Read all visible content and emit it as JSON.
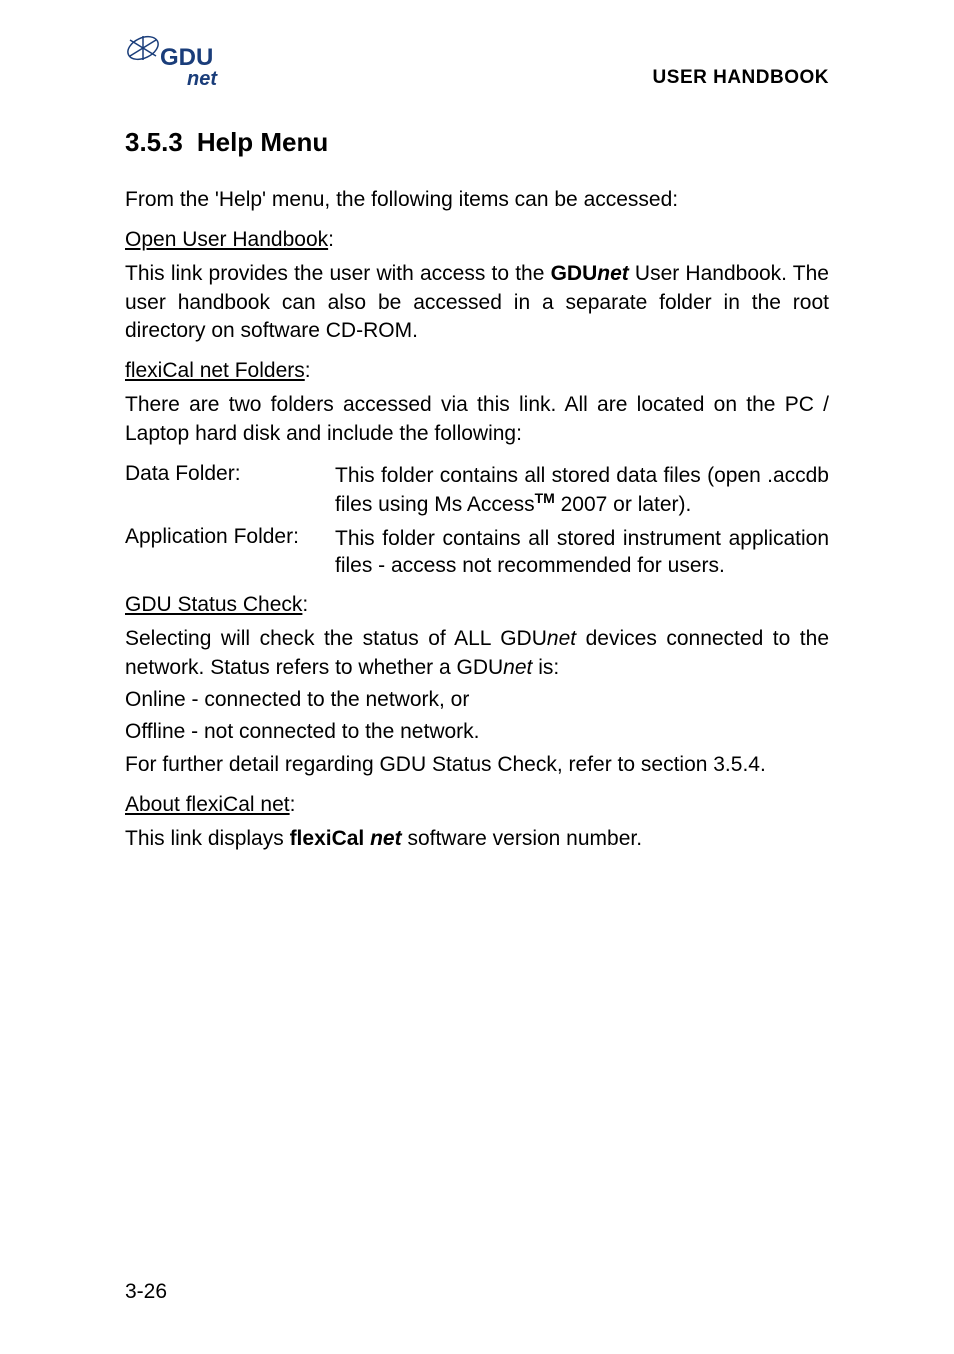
{
  "header": {
    "logo_text_1": "GDU",
    "logo_text_2": "net",
    "title": "USER HANDBOOK"
  },
  "section": {
    "number": "3.5.3",
    "title": "Help Menu"
  },
  "intro": "From the 'Help' menu, the following items can be accessed:",
  "open_handbook": {
    "heading": "Open User Handbook",
    "colon": ":",
    "text_before": "This link provides the user with access to the ",
    "brand_bold": "GDU",
    "brand_italic": "net",
    "text_after": " User Handbook. The user handbook can also be accessed in a separate folder in the root directory on software CD-ROM."
  },
  "flexical_folders": {
    "heading": "flexiCal net Folders",
    "colon": ":",
    "intro": "There are two folders accessed via this link. All are located on the PC / Laptop hard disk and include the following:",
    "data_folder": {
      "label": "Data Folder:",
      "desc_before": "This folder contains all stored data files (open .accdb files using Ms Access",
      "tm": "TM",
      "desc_after": " 2007 or later)."
    },
    "app_folder": {
      "label": "Application Folder:",
      "desc": "This folder contains all stored instrument application files - access not recommended for users."
    }
  },
  "gdu_status": {
    "heading": "GDU Status Check",
    "colon": ":",
    "text1_before": "Selecting will check the status of ALL GDU",
    "text1_italic": "net",
    "text1_mid": " devices connected to the network. Status refers to whether a GDU",
    "text1_italic2": "net",
    "text1_after": " is:",
    "online": "Online - connected to the network, or",
    "offline": "Offline - not connected to the network.",
    "further": "For further detail regarding GDU Status Check, refer to section 3.5.4."
  },
  "about": {
    "heading": "About flexiCal net",
    "colon": ":",
    "text_before": "This link displays ",
    "brand_bold": "flexiCal",
    "brand_italic": " net",
    "text_after": " software version number."
  },
  "page_number": "3-26"
}
